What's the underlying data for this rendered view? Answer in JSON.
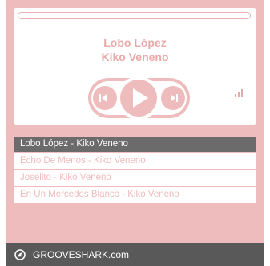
{
  "player": {
    "now_playing": {
      "title": "Lobo López",
      "artist": "Kiko Veneno"
    },
    "progress": 0,
    "controls": {
      "previous_icon": "skip-previous-icon",
      "play_icon": "play-icon",
      "next_icon": "skip-next-icon",
      "volume_icon": "signal-bars-icon"
    }
  },
  "playlist": {
    "tracks": [
      {
        "label": "Lobo López - Kiko Veneno",
        "active": true
      },
      {
        "label": "Echo De Menos - Kiko Veneno",
        "active": false
      },
      {
        "label": "Joselito - Kiko Veneno",
        "active": false
      },
      {
        "label": "En Un Mercedes Blanco - Kiko Veneno",
        "active": false
      }
    ]
  },
  "footer": {
    "brand": "GROOVESHARK.com",
    "logo_icon": "grooveshark-logo-icon"
  },
  "colors": {
    "widget_bg": "#eebcbc",
    "accent_text": "#e9a9a9",
    "active_row": "#6b6b6b",
    "footer_bg": "#595959"
  }
}
